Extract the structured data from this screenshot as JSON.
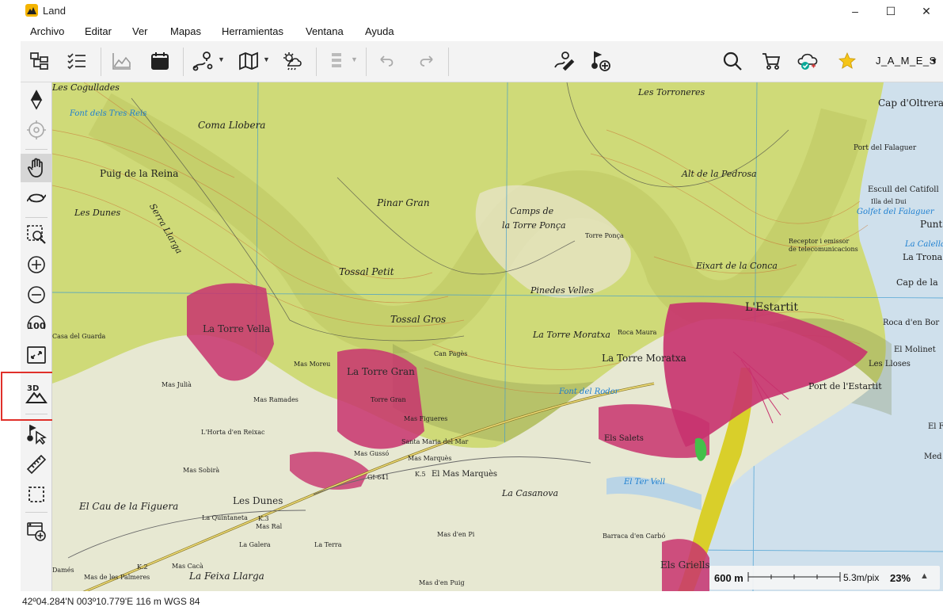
{
  "window": {
    "title": "Land",
    "minimize": "–",
    "maximize": "☐",
    "close": "✕"
  },
  "menu": [
    "Archivo",
    "Editar",
    "Ver",
    "Mapas",
    "Herramientas",
    "Ventana",
    "Ayuda"
  ],
  "user": {
    "name": "J_A_M_E_S",
    "caret": "▾"
  },
  "map_labels": {
    "les_cogullades": "Les Cogullades",
    "font_tres_reis": "Font dels Tres Reis",
    "coma_llobera": "Coma Llobera",
    "puig_reina": "Puig de la Reina",
    "les_dunes_n": "Les Dunes",
    "serra_llarga": "Serra Llarga",
    "pinar_gran": "Pinar Gran",
    "camps_torre": "Camps de",
    "camps_torre2": "la Torre Ponça",
    "torre_ponca": "Torre Ponça",
    "tossal_petit": "Tossal Petit",
    "pinedes_velles": "Pinedes Velles",
    "tossal_gros": "Tossal Gros",
    "la_torre_vella": "La Torre Vella",
    "casa_guarda": "Casa del Guarda",
    "la_torre_gran": "La Torre Gran",
    "mas_moreu": "Mas Moreu",
    "mas_julia": "Mas Julià",
    "mas_ramades": "Mas Ramades",
    "torre_gran_small": "Torre Gran",
    "can_pages": "Can Pagès",
    "la_torre_moratxa": "La Torre Moratxa",
    "roca_maura": "Roca Maura",
    "la_torre_moratxa2": "La Torre Moratxa",
    "font_rodor": "Font del Rodor",
    "les_torroneres": "Les Torroneres",
    "alt_pedrosa": "Alt de la Pedrosa",
    "eixart_conca": "Eixart de la Conca",
    "receptor": "Receptor i emissor",
    "receptor2": "de telecomunicacions",
    "l_estartit": "L'Estartit",
    "port_estartit": "Port de l'Estartit",
    "cap_oltrera": "Cap d'Oltrera",
    "port_falaguer": "Port del Falaguer",
    "escull_catifoll": "Escull del Catifoll",
    "illa_dui": "Illa del Dui",
    "golfet_falaguer": "Golfet del Falaguer",
    "punta": "Punta",
    "la_calella": "La Calella",
    "la_trona": "La Trona",
    "cap_la": "Cap de la",
    "roca_bor": "Roca d'en Bor",
    "el_molinet": "El Molinet",
    "les_lloses": "Les Lloses",
    "el_f": "El F",
    "med": "Med",
    "horta_reixac": "L'Horta d'en Reixac",
    "mas_figueres": "Mas Figueres",
    "santa_maria_mar": "Santa Maria del Mar",
    "mas_gusso": "Mas Gussó",
    "mas_marques": "Mas Marquès",
    "el_mas_marques": "El Mas Marquès",
    "mas_sobira": "Mas Sobirà",
    "gi641": "GI-641",
    "el_cau_figuera": "El Cau de la Figuera",
    "les_dunes_s": "Les Dunes",
    "la_quintaneta": "La Quintaneta",
    "mas_ral": "Mas Ral",
    "la_galera": "La Galera",
    "la_terra": "La Terra",
    "la_casanova": "La Casanova",
    "el_ter_vell": "El Ter Vell",
    "els_salets": "Els Salets",
    "mas_den_pi": "Mas d'en Pi",
    "barraca_carbo": "Barraca d'en Carbó",
    "els_griells": "Els Griells",
    "dames": "Damés",
    "mas_caca": "Mas Cacà",
    "mas_palmeres": "Mas de les Palmeres",
    "la_feixa_llarga": "La Feixa Llarga",
    "mas_puig": "Mas d'en Puig",
    "k3": "K.3",
    "k2": "K.2",
    "k5": "K.5"
  },
  "scale": {
    "distance": "600 m",
    "resolution": "5.3m/pix",
    "zoom": "23%",
    "arrow": "▲"
  },
  "status": {
    "coords": "42º04.284'N 003º10.779'E 116 m  WGS 84"
  },
  "colors": {
    "map_bg": "#dfe8c6",
    "forest": "#c9d86a",
    "urban": "#c8326e",
    "sea": "#cfe0ec",
    "beach": "#d9cf2a",
    "highlight": "#e0302a"
  }
}
